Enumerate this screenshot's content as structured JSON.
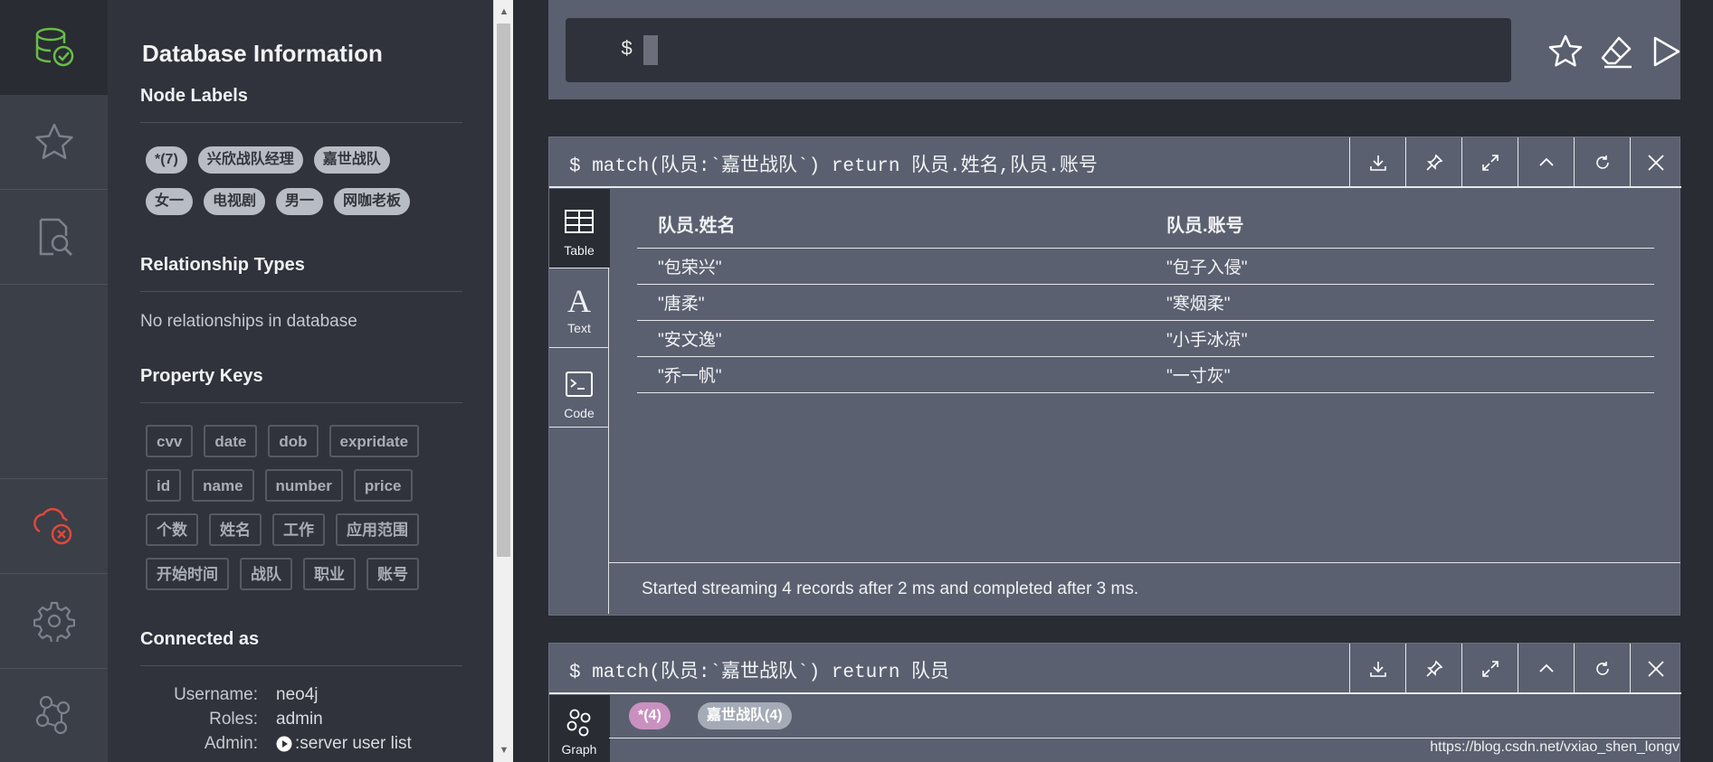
{
  "nav": {
    "items": [
      {
        "icon": "database-check-icon",
        "active": true
      },
      {
        "icon": "star-icon"
      },
      {
        "icon": "document-search-icon"
      },
      {
        "icon": "database-disconnect-icon",
        "color": "#e0483b"
      },
      {
        "icon": "gear-icon"
      },
      {
        "icon": "neo4j-logo-icon"
      }
    ]
  },
  "drawer": {
    "title": "Database Information",
    "node_labels": {
      "heading": "Node Labels",
      "items": [
        "*(7)",
        "兴欣战队经理",
        "嘉世战队",
        "女一",
        "电视剧",
        "男一",
        "网咖老板"
      ]
    },
    "relationship_types": {
      "heading": "Relationship Types",
      "empty_text": "No relationships in database"
    },
    "property_keys": {
      "heading": "Property Keys",
      "items": [
        "cvv",
        "date",
        "dob",
        "expridate",
        "id",
        "name",
        "number",
        "price",
        "个数",
        "姓名",
        "工作",
        "应用范围",
        "开始时间",
        "战队",
        "职业",
        "账号"
      ]
    },
    "connected_as": {
      "heading": "Connected as",
      "username_label": "Username:",
      "username": "neo4j",
      "roles_label": "Roles:",
      "roles": "admin",
      "admin_label": "Admin:",
      "admin_link": ":server user list"
    }
  },
  "editor": {
    "prompt": "$",
    "value": ""
  },
  "frames": [
    {
      "query": "$ match(队员:`嘉世战队`) return 队员.姓名,队员.账号",
      "tabs": [
        "Table",
        "Text",
        "Code"
      ],
      "active_tab": "Table",
      "columns": [
        "队员.姓名",
        "队员.账号"
      ],
      "rows": [
        [
          "\"包荣兴\"",
          "\"包子入侵\""
        ],
        [
          "\"唐柔\"",
          "\"寒烟柔\""
        ],
        [
          "\"安文逸\"",
          "\"小手冰凉\""
        ],
        [
          "\"乔一帆\"",
          "\"一寸灰\""
        ]
      ],
      "status": "Started streaming 4 records after 2 ms and completed after 3 ms."
    },
    {
      "query": "$ match(队员:`嘉世战队`) return 队员",
      "tabs": [
        "Graph"
      ],
      "legend": [
        {
          "label": "*(4)",
          "color": "#c990c0"
        },
        {
          "label": "嘉世战队(4)",
          "color": "#a5abb6"
        }
      ]
    }
  ],
  "watermark": "https://blog.csdn.net/vxiao_shen_longv"
}
